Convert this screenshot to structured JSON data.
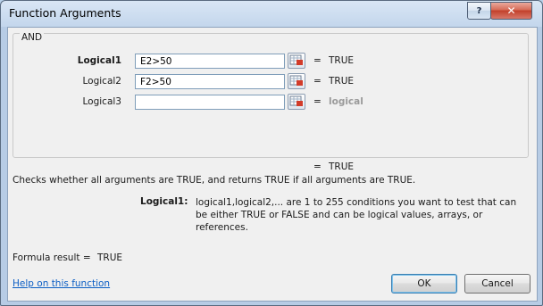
{
  "window": {
    "title": "Function Arguments",
    "help_glyph": "?",
    "close_glyph": "✕"
  },
  "function": {
    "name": "AND",
    "arguments": [
      {
        "label": "Logical1",
        "value": "E2>50",
        "equals": "=",
        "result": "TRUE"
      },
      {
        "label": "Logical2",
        "value": "F2>50",
        "equals": "=",
        "result": "TRUE"
      },
      {
        "label": "Logical3",
        "value": "",
        "equals": "=",
        "result": "logical"
      }
    ],
    "overall_equals": "=",
    "overall_result": "TRUE",
    "description": "Checks whether all arguments are TRUE, and returns TRUE if all arguments are TRUE.",
    "param_name": "Logical1:",
    "param_description": "logical1,logical2,... are 1 to 255 conditions you want to test that can be either TRUE or FALSE and can be logical values, arrays, or references."
  },
  "footer": {
    "formula_result_label": "Formula result =",
    "formula_result_value": "TRUE",
    "help_link": "Help on this function",
    "ok_label": "OK",
    "cancel_label": "Cancel"
  }
}
